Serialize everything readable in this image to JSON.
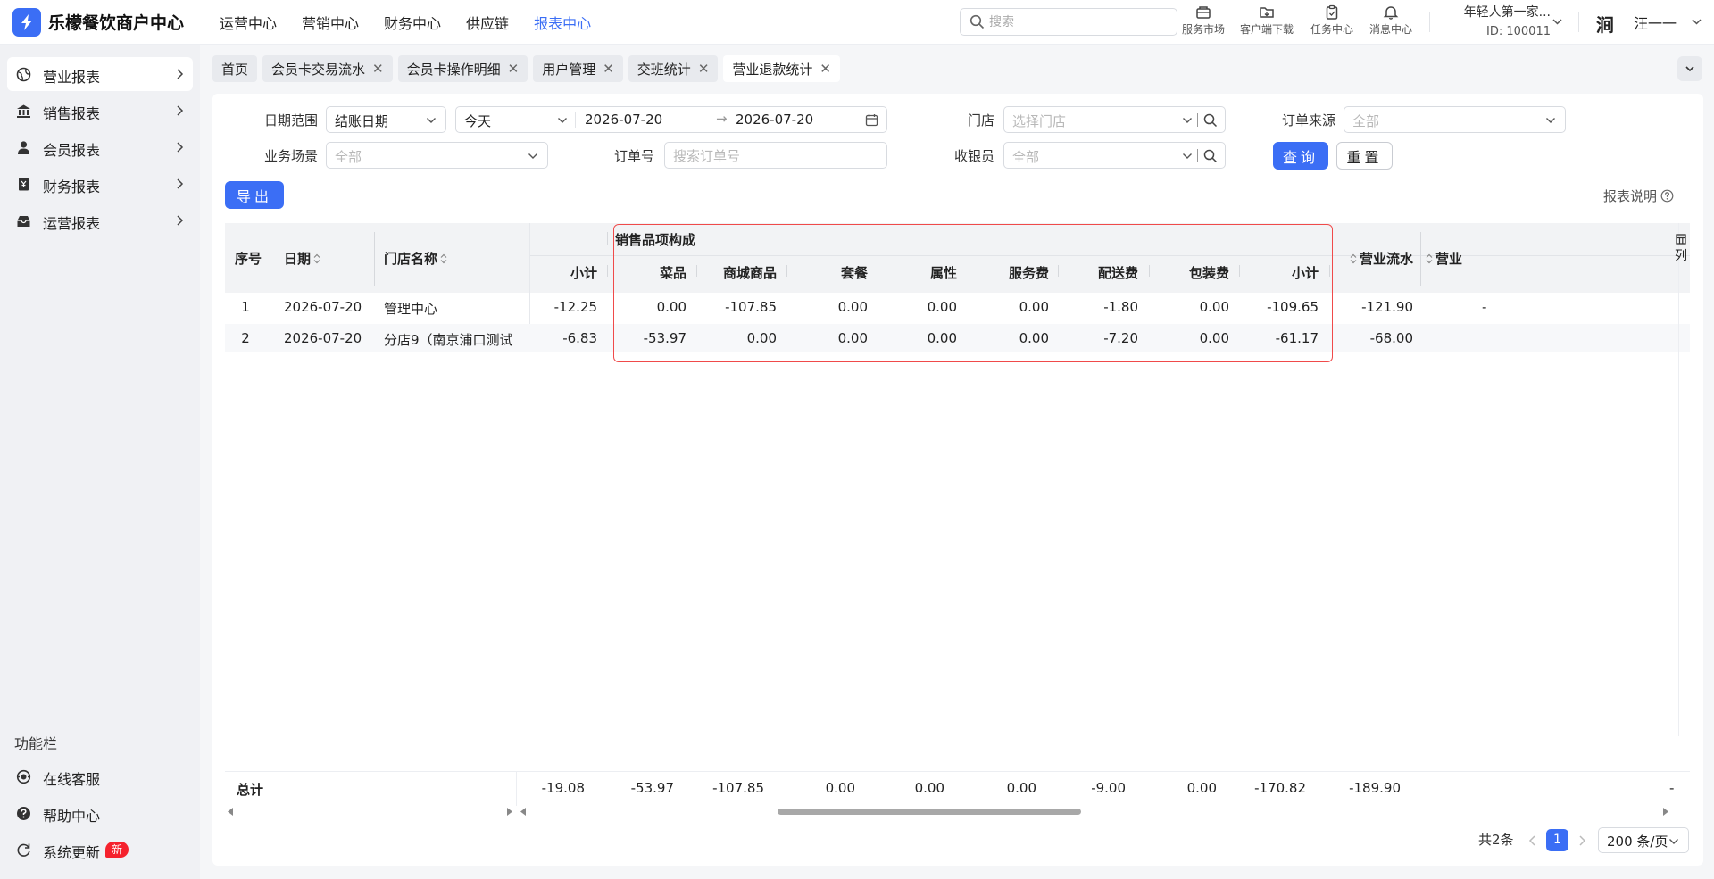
{
  "app": {
    "brand": "乐檬餐饮商户中心"
  },
  "topnav": {
    "items": [
      "运营中心",
      "营销中心",
      "财务中心",
      "供应链",
      "报表中心"
    ],
    "active": "报表中心"
  },
  "search": {
    "placeholder": "搜索",
    "value": ""
  },
  "tools": {
    "market": "服务市场",
    "download": "客户端下载",
    "tasks": "任务中心",
    "messages": "消息中心"
  },
  "account": {
    "name": "年轻人第一家...",
    "id": "ID: 100011"
  },
  "user": {
    "avatar_text": "涧",
    "name": "汪一一"
  },
  "sidebar": {
    "items": [
      {
        "label": "营业报表",
        "icon": "globe-icon",
        "active": true
      },
      {
        "label": "销售报表",
        "icon": "bank-icon"
      },
      {
        "label": "会员报表",
        "icon": "user-icon"
      },
      {
        "label": "财务报表",
        "icon": "ledger-icon"
      },
      {
        "label": "运营报表",
        "icon": "tray-icon"
      }
    ],
    "func_title": "功能栏",
    "func_items": [
      {
        "label": "在线客服",
        "icon": "headset-icon"
      },
      {
        "label": "帮助中心",
        "icon": "help-icon"
      },
      {
        "label": "系统更新",
        "icon": "refresh-icon",
        "badge": "新"
      }
    ]
  },
  "tabs": [
    "首页",
    "会员卡交易流水",
    "会员卡操作明细",
    "用户管理",
    "交班统计",
    "营业退款统计"
  ],
  "active_tab": "营业退款统计",
  "filters": {
    "date_range_label": "日期范围",
    "date_type": "结账日期",
    "date_preset": "今天",
    "date_start": "2026-07-20",
    "date_sep": "→",
    "date_end": "2026-07-20",
    "store_label": "门店",
    "store_placeholder": "选择门店",
    "order_source_label": "订单来源",
    "order_source_value": "全部",
    "scene_label": "业务场景",
    "scene_value": "全部",
    "order_no_label": "订单号",
    "order_no_placeholder": "搜索订单号",
    "cashier_label": "收银员",
    "cashier_value": "全部",
    "query_button": "查询",
    "reset_button": "重置"
  },
  "export_button": "导出",
  "report_help": "报表说明",
  "table": {
    "headers": {
      "seq": "序号",
      "date": "日期",
      "store": "门店名称",
      "subtotal0": "小计",
      "group": "销售品项构成",
      "dish": "菜品",
      "mall": "商城商品",
      "combo": "套餐",
      "attr": "属性",
      "service": "服务费",
      "delivery": "配送费",
      "packing": "包装费",
      "subtotal": "小计",
      "flow": "营业流水",
      "cut": "营业"
    },
    "rows": [
      {
        "seq": "1",
        "date": "2026-07-20",
        "store": "管理中心",
        "subtotal0": "-12.25",
        "dish": "0.00",
        "mall": "-107.85",
        "combo": "0.00",
        "attr": "0.00",
        "service": "0.00",
        "delivery": "-1.80",
        "packing": "0.00",
        "subtotal": "-109.65",
        "flow": "-121.90",
        "cut": "-"
      },
      {
        "seq": "2",
        "date": "2026-07-20",
        "store": "分店9（南京浦口测试",
        "subtotal0": "-6.83",
        "dish": "-53.97",
        "mall": "0.00",
        "combo": "0.00",
        "attr": "0.00",
        "service": "0.00",
        "delivery": "-7.20",
        "packing": "0.00",
        "subtotal": "-61.17",
        "flow": "-68.00",
        "cut": ""
      }
    ],
    "total": {
      "label": "总计",
      "subtotal0": "-19.08",
      "dish": "-53.97",
      "mall": "-107.85",
      "combo": "0.00",
      "attr": "0.00",
      "service": "0.00",
      "delivery": "-9.00",
      "packing": "0.00",
      "subtotal": "-170.82",
      "flow": "-189.90",
      "cut": "-"
    },
    "column_settings": "列"
  },
  "pagination": {
    "total_text": "共2条",
    "current_page": "1",
    "page_size": "200 条/页"
  },
  "colors": {
    "accent": "#3b6ef5",
    "highlight_box": "#f04a4a",
    "badge": "#f5222d"
  }
}
